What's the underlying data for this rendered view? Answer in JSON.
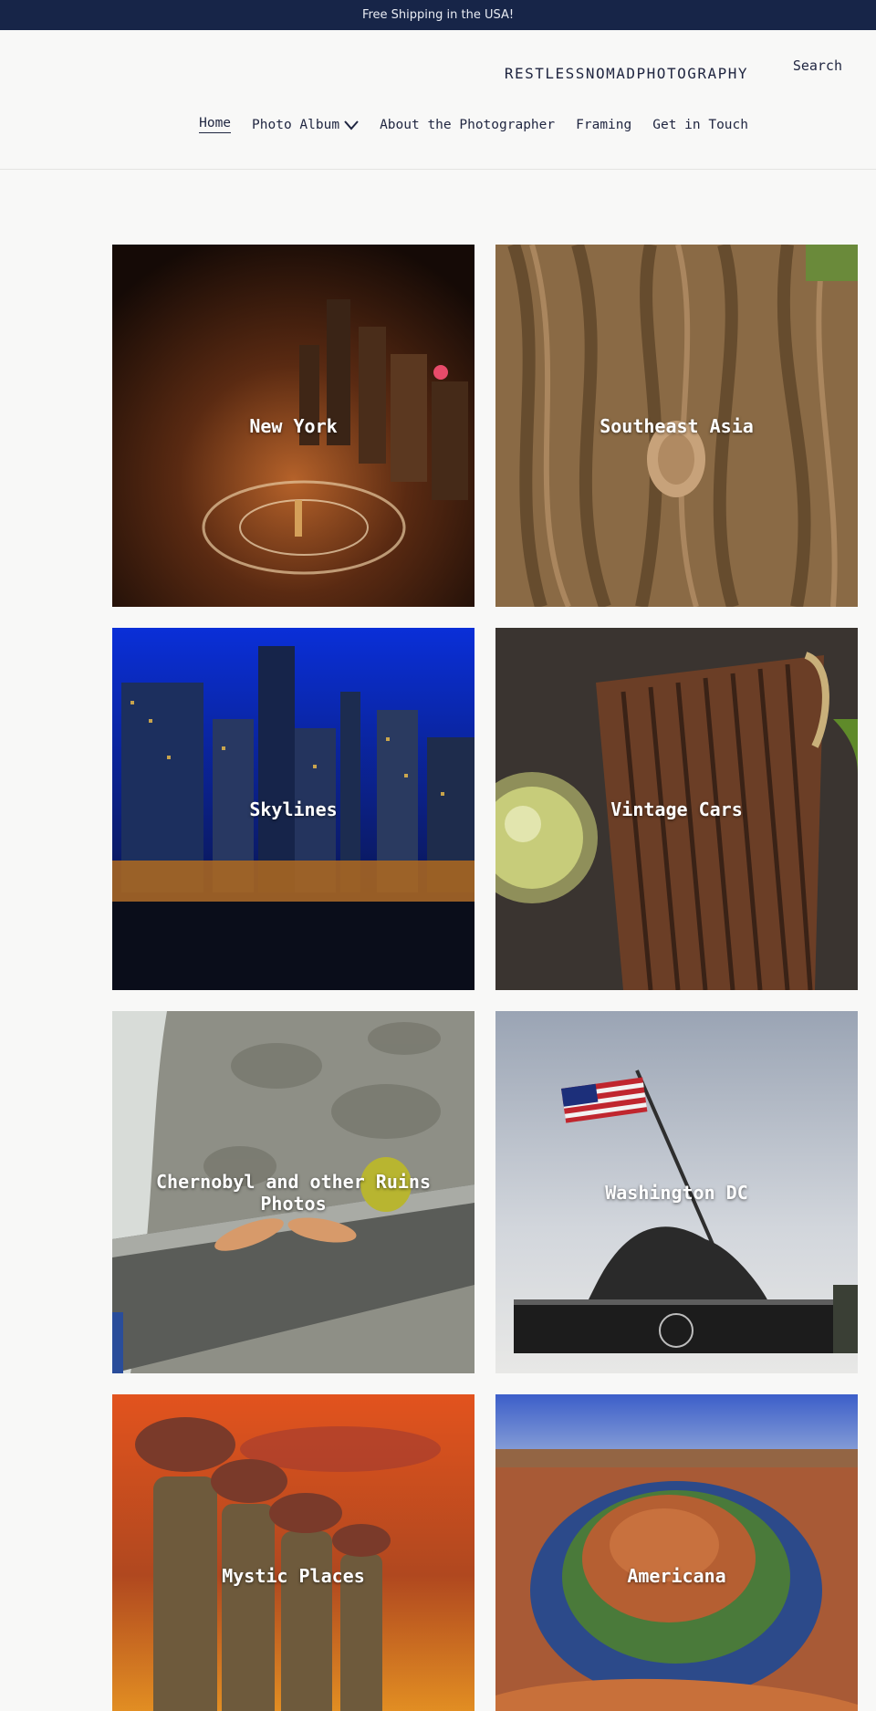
{
  "announcement": "Free Shipping in the USA!",
  "header": {
    "site_title": "RESTLESSNOMADPHOTOGRAPHY",
    "search_label": "Search",
    "nav": [
      {
        "label": "Home",
        "active": true
      },
      {
        "label": "Photo Album",
        "has_dropdown": true
      },
      {
        "label": "About the Photographer"
      },
      {
        "label": "Framing"
      },
      {
        "label": "Get in Touch"
      }
    ]
  },
  "gallery": [
    {
      "title": "New York",
      "image": "new-york-night-aerial"
    },
    {
      "title": "Southeast Asia",
      "image": "buddha-head-in-tree-roots"
    },
    {
      "title": "Skylines",
      "image": "chicago-skyline-night"
    },
    {
      "title": "Vintage Cars",
      "image": "rusty-vintage-car-grille"
    },
    {
      "title": "Chernobyl and other Ruins Photos",
      "image": "abandoned-doll-ruins"
    },
    {
      "title": "Washington DC",
      "image": "iwo-jima-memorial-flag"
    },
    {
      "title": "Mystic Places",
      "image": "easter-island-moai-sunset"
    },
    {
      "title": "Americana",
      "image": "horseshoe-bend-canyon"
    }
  ],
  "colors": {
    "announcement_bg": "#172548",
    "text_primary": "#1f2540",
    "page_bg": "#f8f8f7"
  }
}
